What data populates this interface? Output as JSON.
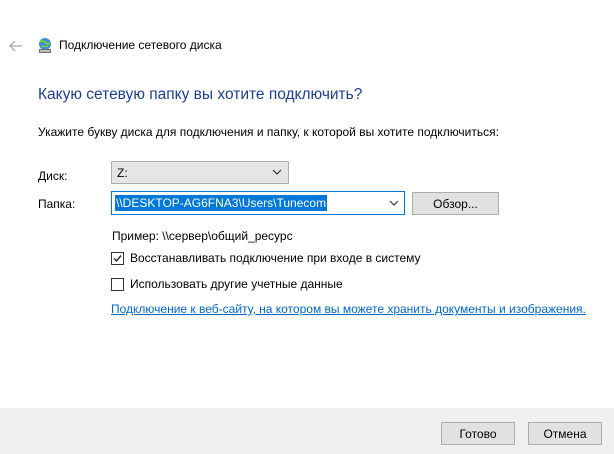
{
  "window": {
    "title": "Подключение сетевого диска",
    "back_icon": "back-arrow-icon",
    "app_icon": "network-drive-icon"
  },
  "main": {
    "heading": "Какую сетевую папку вы хотите подключить?",
    "instruction": "Укажите букву диска для подключения и папку, к которой вы хотите подключиться:"
  },
  "form": {
    "drive": {
      "label": "Диск:",
      "value": "Z:"
    },
    "folder": {
      "label": "Папка:",
      "value": "\\\\DESKTOP-AG6FNA3\\Users\\Tunecom"
    },
    "browse_label": "Обзор...",
    "example": "Пример: \\\\сервер\\общий_ресурс",
    "reconnect": {
      "label": "Восстанавливать подключение при входе в систему",
      "checked": true
    },
    "other_credentials": {
      "label": "Использовать другие учетные данные",
      "checked": false
    },
    "web_link": "Подключение к веб-сайту, на котором вы можете хранить документы и изображения."
  },
  "footer": {
    "ok_label": "Готово",
    "cancel_label": "Отмена"
  },
  "colors": {
    "heading": "#1c3f94",
    "accent": "#0078d7",
    "link": "#0066cc",
    "footer_bg": "#f0f0f0"
  }
}
